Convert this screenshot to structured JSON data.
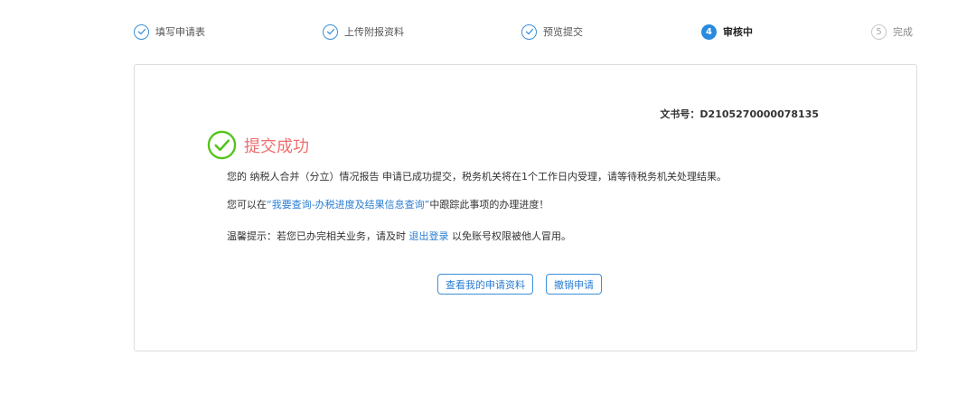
{
  "steps": [
    {
      "label": "填写申请表",
      "state": "done",
      "icon": "check-icon"
    },
    {
      "label": "上传附报资料",
      "state": "done",
      "icon": "check-icon"
    },
    {
      "label": "预览提交",
      "state": "done",
      "icon": "check-icon"
    },
    {
      "label": "审核中",
      "state": "active",
      "number": "4"
    },
    {
      "label": "完成",
      "state": "todo",
      "number": "5"
    }
  ],
  "card": {
    "doc_number": "文书号：D2105270000078135",
    "success_title": "提交成功",
    "success_icon": "check-circle-icon",
    "line1": "您的 纳税人合并（分立）情况报告 申请已成功提交，税务机关将在1个工作日内受理，请等待税务机关处理结果。",
    "line2_prefix": "您可以在",
    "line2_link": "“我要查询-办税进度及结果信息查询”",
    "line2_suffix": "中跟踪此事项的办理进度！",
    "line3_prefix": "温馨提示：若您已办完相关业务，请及时 ",
    "line3_link": "退出登录",
    "line3_suffix": " 以免账号权限被他人冒用。",
    "buttons": {
      "view_label": "查看我的申请资料",
      "cancel_label": "撤销申请"
    }
  },
  "colors": {
    "accent": "#2a8bde",
    "success_green": "#52c41a",
    "success_text": "#ef6f6f",
    "link": "#2a7ed3"
  }
}
